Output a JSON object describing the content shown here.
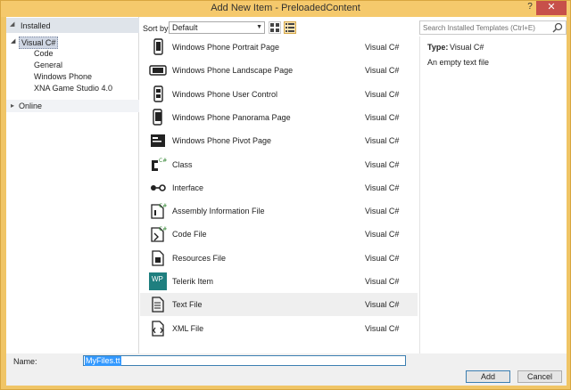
{
  "window": {
    "title": "Add New Item - PreloadedContent",
    "help_glyph": "?",
    "close_glyph": "✕"
  },
  "tree": {
    "installed_label": "Installed",
    "root_label": "Visual C#",
    "children": [
      "Code",
      "General",
      "Windows Phone",
      "XNA Game Studio 4.0"
    ],
    "online_label": "Online"
  },
  "toolbar": {
    "sort_label": "Sort by:",
    "sort_value": "Default"
  },
  "search": {
    "placeholder": "Search Installed Templates (Ctrl+E)"
  },
  "items": [
    {
      "name": "Windows Phone Portrait Page",
      "lang": "Visual C#",
      "icon": "phone-portrait-icon"
    },
    {
      "name": "Windows Phone Landscape Page",
      "lang": "Visual C#",
      "icon": "phone-landscape-icon"
    },
    {
      "name": "Windows Phone User Control",
      "lang": "Visual C#",
      "icon": "phone-user-control-icon"
    },
    {
      "name": "Windows Phone Panorama Page",
      "lang": "Visual C#",
      "icon": "phone-panorama-icon"
    },
    {
      "name": "Windows Phone Pivot Page",
      "lang": "Visual C#",
      "icon": "phone-pivot-icon"
    },
    {
      "name": "Class",
      "lang": "Visual C#",
      "icon": "class-icon"
    },
    {
      "name": "Interface",
      "lang": "Visual C#",
      "icon": "interface-icon"
    },
    {
      "name": "Assembly Information File",
      "lang": "Visual C#",
      "icon": "assembly-info-icon"
    },
    {
      "name": "Code File",
      "lang": "Visual C#",
      "icon": "code-file-icon"
    },
    {
      "name": "Resources File",
      "lang": "Visual C#",
      "icon": "resources-file-icon"
    },
    {
      "name": "Telerik Item",
      "lang": "Visual C#",
      "icon": "telerik-wp-icon",
      "badge": "WP"
    },
    {
      "name": "Text File",
      "lang": "Visual C#",
      "icon": "text-file-icon"
    },
    {
      "name": "XML File",
      "lang": "Visual C#",
      "icon": "xml-file-icon"
    }
  ],
  "selected_index": 11,
  "detail": {
    "type_label": "Type:",
    "type_value": "Visual C#",
    "description": "An empty text file"
  },
  "bottom": {
    "name_label": "Name:",
    "name_value": "MyFiles.tt",
    "add_label": "Add",
    "cancel_label": "Cancel"
  }
}
